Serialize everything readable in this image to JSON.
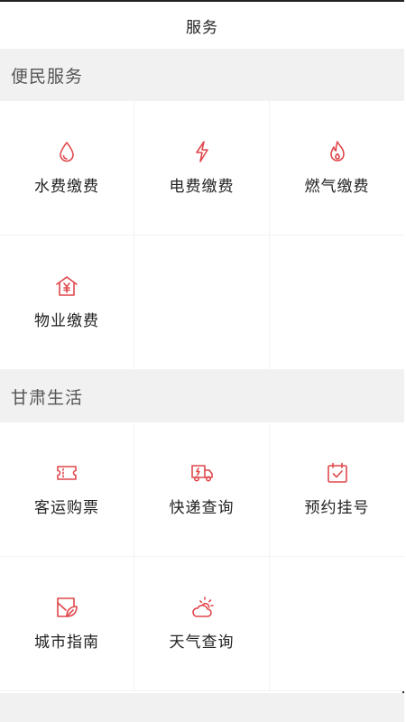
{
  "header": {
    "title": "服务"
  },
  "sections": [
    {
      "title": "便民服务",
      "items": [
        {
          "label": "水费缴费",
          "icon": "water-drop-icon"
        },
        {
          "label": "电费缴费",
          "icon": "lightning-icon"
        },
        {
          "label": "燃气缴费",
          "icon": "flame-icon"
        },
        {
          "label": "物业缴费",
          "icon": "house-yen-icon"
        }
      ]
    },
    {
      "title": "甘肃生活",
      "items": [
        {
          "label": "客运购票",
          "icon": "ticket-icon"
        },
        {
          "label": "快递查询",
          "icon": "delivery-truck-icon"
        },
        {
          "label": "预约挂号",
          "icon": "calendar-check-icon"
        },
        {
          "label": "城市指南",
          "icon": "map-leaf-icon"
        },
        {
          "label": "天气查询",
          "icon": "sun-cloud-icon"
        }
      ]
    }
  ],
  "colors": {
    "accent": "#e0474c",
    "section_bg": "#f1f1f1"
  }
}
